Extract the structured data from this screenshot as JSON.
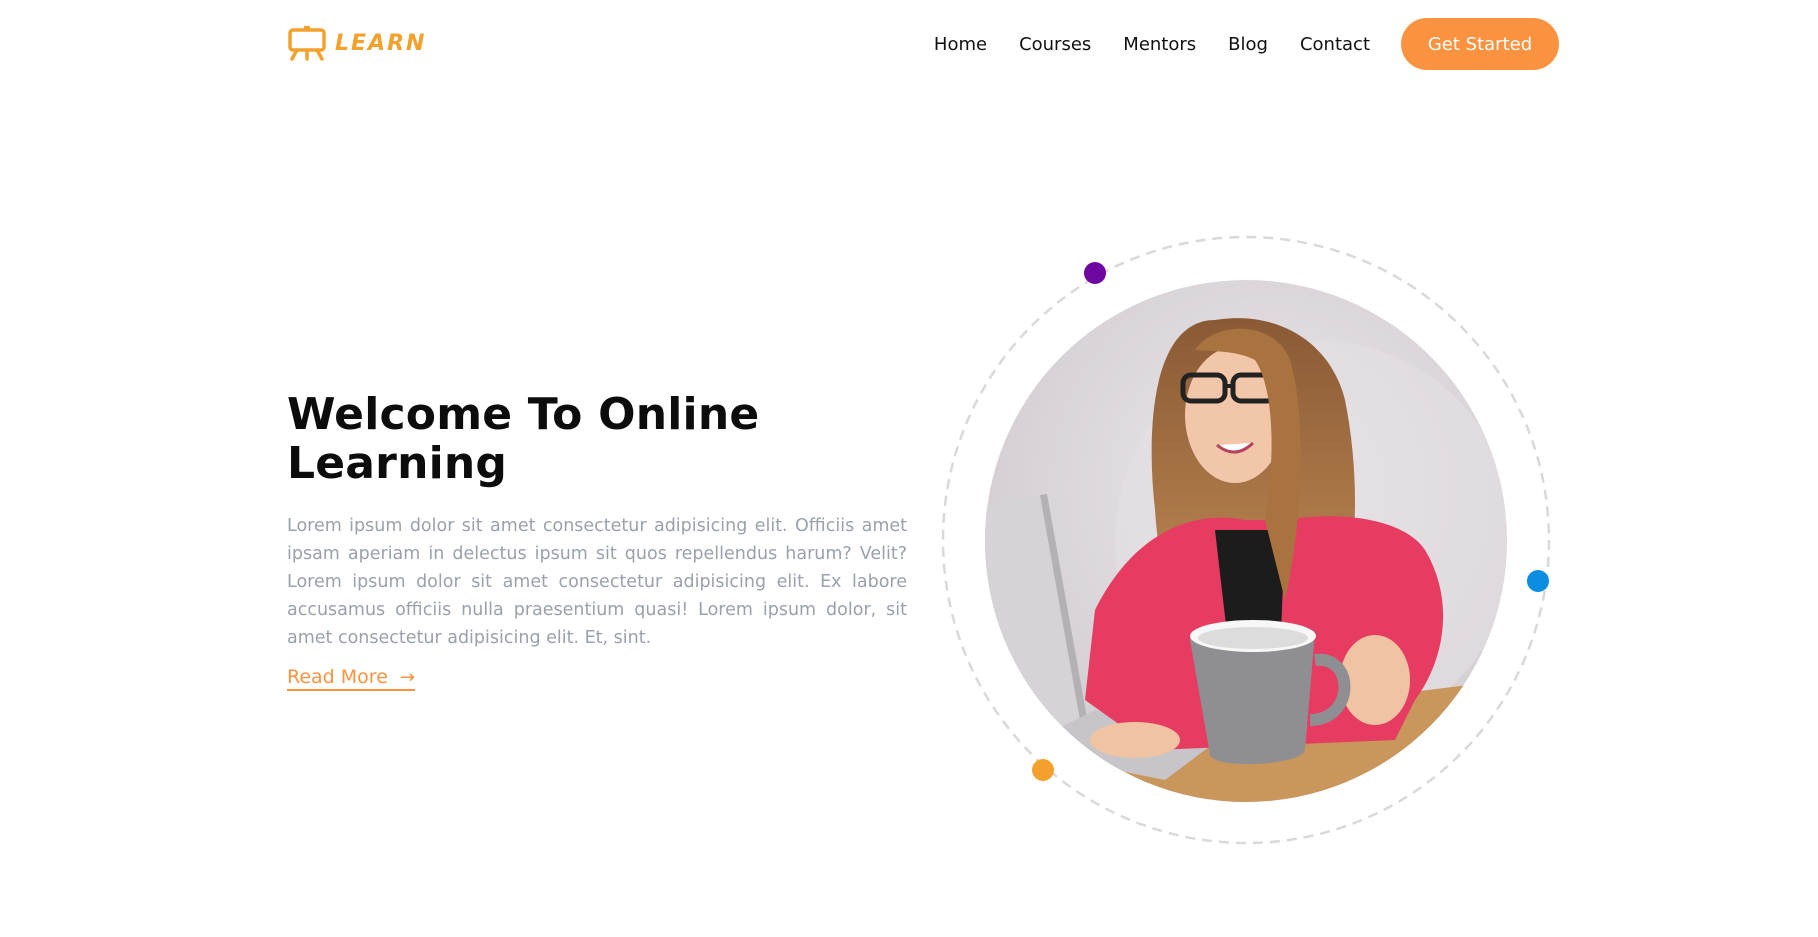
{
  "brand": {
    "name": "LEARN",
    "color": "#F3A12C",
    "icon": "presentation-board-icon"
  },
  "nav": {
    "links": [
      "Home",
      "Courses",
      "Mentors",
      "Blog",
      "Contact"
    ],
    "cta_label": "Get Started",
    "cta_color": "#FB923F"
  },
  "hero": {
    "title": "Welcome To Online Learning",
    "description": "Lorem ipsum dolor sit amet consectetur adipisicing elit. Officiis amet ipsam aperiam in delectus ipsum sit quos repellendus harum? Velit?Lorem ipsum dolor sit amet consectetur adipisicing elit. Ex labore accusamus officiis nulla praesentium quasi! Lorem ipsum dolor, sit amet consectetur adipisicing elit. Et, sint.",
    "read_more_label": "Read More",
    "read_more_icon": "arrow-right-icon",
    "accent_color": "#FB923F"
  },
  "visual": {
    "photo": "woman-at-laptop-with-mug-photo",
    "dot_colors": [
      "#6E07A0",
      "#0B8DE0",
      "#F3A12C"
    ]
  }
}
